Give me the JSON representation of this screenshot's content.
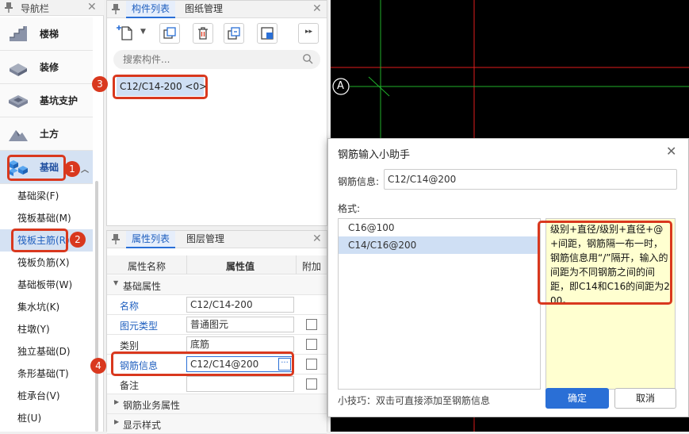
{
  "nav": {
    "title": "导航栏",
    "categories": [
      {
        "label": "楼梯"
      },
      {
        "label": "装修"
      },
      {
        "label": "基坑支护"
      },
      {
        "label": "土方"
      },
      {
        "label": "基础"
      }
    ],
    "items": [
      {
        "label": "基础梁(F)"
      },
      {
        "label": "筏板基础(M)"
      },
      {
        "label": "筏板主筋(R)"
      },
      {
        "label": "筏板负筋(X)"
      },
      {
        "label": "基础板带(W)"
      },
      {
        "label": "集水坑(K)"
      },
      {
        "label": "柱墩(Y)"
      },
      {
        "label": "独立基础(D)"
      },
      {
        "label": "条形基础(T)"
      },
      {
        "label": "桩承台(V)"
      },
      {
        "label": "桩(U)"
      }
    ]
  },
  "components": {
    "tabs": [
      "构件列表",
      "图纸管理"
    ],
    "search_placeholder": "搜索构件...",
    "selected_item": "C12/C14-200 <0>"
  },
  "properties": {
    "tabs": [
      "属性列表",
      "图层管理"
    ],
    "headers": [
      "属性名称",
      "属性值",
      "附加"
    ],
    "group_basic": "基础属性",
    "rows": [
      {
        "name": "名称",
        "value": "C12/C14-200"
      },
      {
        "name": "图元类型",
        "value": "普通图元"
      },
      {
        "name": "类别",
        "value": "底筋"
      },
      {
        "name": "钢筋信息",
        "value": "C12/C14@200"
      },
      {
        "name": "备注",
        "value": ""
      }
    ],
    "group_business": "钢筋业务属性",
    "group_display": "显示样式"
  },
  "annotations": [
    "1",
    "2",
    "3",
    "4"
  ],
  "canvas": {
    "axis_label": "A"
  },
  "dialog": {
    "title": "钢筋输入小助手",
    "info_label": "钢筋信息:",
    "info_value": "C12/C14@200",
    "format_label": "格式:",
    "formats": [
      "C16@100",
      "C14/C16@200"
    ],
    "description": "级别+直径/级别+直径+@+间距，钢筋隔一布一时，钢筋信息用“/”隔开，输入的间距为不同钢筋之间的间距，即C14和C16的间距为200。",
    "tip": "小技巧：双击可直接添加至钢筋信息",
    "ok": "确定",
    "cancel": "取消"
  },
  "colors": {
    "accent": "#2a6fd6",
    "annotation": "#d9381e",
    "description_bg": "#ffffd0"
  }
}
